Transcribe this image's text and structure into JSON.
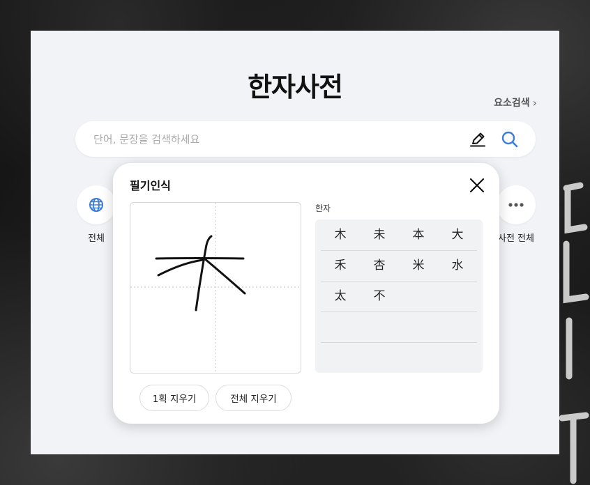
{
  "page": {
    "title": "한자사전",
    "element_search_label": "요소검색",
    "accent_color": "#3d7bd9"
  },
  "search": {
    "placeholder": "단어, 문장을 검색하세요",
    "value": ""
  },
  "categories": [
    {
      "label": "전체",
      "icon": "globe-icon"
    },
    {
      "label": "사전 전체",
      "icon": "more-icon"
    }
  ],
  "handwriting": {
    "title": "필기인식",
    "candidates_label": "한자",
    "candidates": [
      [
        "木",
        "未",
        "本",
        "大"
      ],
      [
        "禾",
        "杏",
        "米",
        "水"
      ],
      [
        "太",
        "不"
      ]
    ],
    "undo_stroke_label": "1획 지우기",
    "clear_all_label": "전체 지우기"
  }
}
